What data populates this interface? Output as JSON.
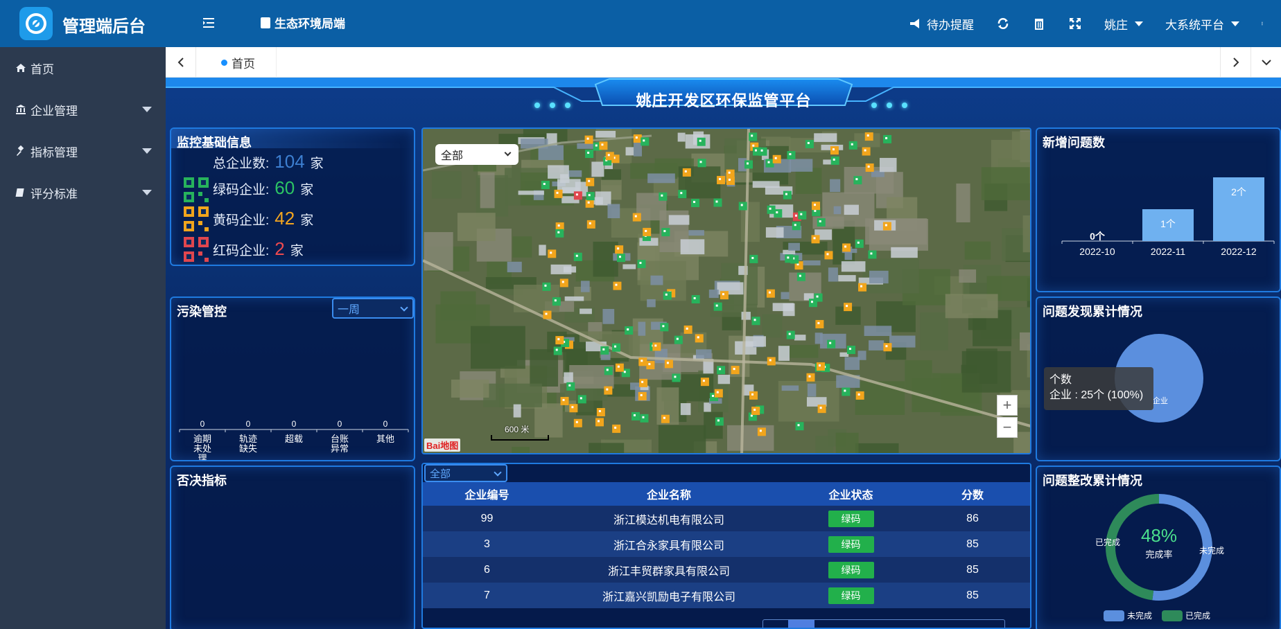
{
  "header": {
    "app_title": "管理端后台",
    "portal": "生态环境局端",
    "todo": "待办提醒",
    "user": "姚庄",
    "platform": "大系统平台",
    "colors": {
      "bar": "#0b5fa5",
      "sidebar": "#2c3a4f"
    }
  },
  "sidebar": {
    "items": [
      {
        "label": "首页",
        "icon": "home-icon"
      },
      {
        "label": "企业管理",
        "icon": "bank-icon"
      },
      {
        "label": "指标管理",
        "icon": "gavel-icon"
      },
      {
        "label": "评分标准",
        "icon": "book-icon"
      }
    ]
  },
  "tabs": {
    "home": "首页"
  },
  "dashboard": {
    "title": "姚庄开发区环保监管平台",
    "monitor": {
      "title": "监控基础信息",
      "total_label": "总企业数:",
      "total_value": "104",
      "green_label": "绿码企业:",
      "green_value": "60",
      "yellow_label": "黄码企业:",
      "yellow_value": "42",
      "red_label": "红码企业:",
      "red_value": "2",
      "unit": "家"
    },
    "pollution": {
      "title": "污染管控",
      "filter": "一周",
      "chart_data": {
        "type": "bar",
        "categories": [
          "逾期未处理",
          "轨迹缺失",
          "超载",
          "台账异常",
          "其他"
        ],
        "category_lines": [
          [
            "逾期",
            "未处",
            "理"
          ],
          [
            "轨迹",
            "缺失"
          ],
          [
            "超载"
          ],
          [
            "台账",
            "异常"
          ],
          [
            "其他"
          ]
        ],
        "values": [
          0,
          0,
          0,
          0,
          0
        ]
      }
    },
    "veto": {
      "title": "否决指标"
    },
    "map": {
      "filter": "全部",
      "scale": "600 米",
      "provider": "Bai地图"
    },
    "table": {
      "filter": "全部",
      "headers": [
        "企业编号",
        "企业名称",
        "企业状态",
        "分数"
      ],
      "rows": [
        {
          "id": "99",
          "name": "浙江模达机电有限公司",
          "status": "绿码",
          "score": "86"
        },
        {
          "id": "3",
          "name": "浙江合永家具有限公司",
          "status": "绿码",
          "score": "85"
        },
        {
          "id": "6",
          "name": "浙江丰贸群家具有限公司",
          "status": "绿码",
          "score": "85"
        },
        {
          "id": "7",
          "name": "浙江嘉兴凯励电子有限公司",
          "status": "绿码",
          "score": "85"
        }
      ]
    },
    "new_issues": {
      "title": "新增问题数",
      "chart_data": {
        "type": "bar",
        "categories": [
          "2022-10",
          "2022-11",
          "2022-12"
        ],
        "values": [
          0,
          1,
          2
        ],
        "data_labels": [
          "0个",
          "1个",
          "2个"
        ],
        "color": "#6fb1f0"
      }
    },
    "found": {
      "title": "问题发现累计情况",
      "tooltip_title": "个数",
      "tooltip_value": "企业 : 25个 (100%)",
      "slice_label": "企业",
      "chart_data": {
        "type": "pie",
        "slices": [
          {
            "label": "企业",
            "value": 25,
            "percent": 100
          }
        ],
        "color": "#5b8fde"
      }
    },
    "rectify": {
      "title": "问题整改累计情况",
      "percent": "48%",
      "rate_label": "完成率",
      "done_label": "已完成",
      "undone_label": "未完成",
      "chart_data": {
        "type": "pie",
        "slices": [
          {
            "label": "未完成",
            "percent": 52,
            "color": "#5b8fde"
          },
          {
            "label": "已完成",
            "percent": 48,
            "color": "#2e8a5a"
          }
        ]
      }
    }
  }
}
